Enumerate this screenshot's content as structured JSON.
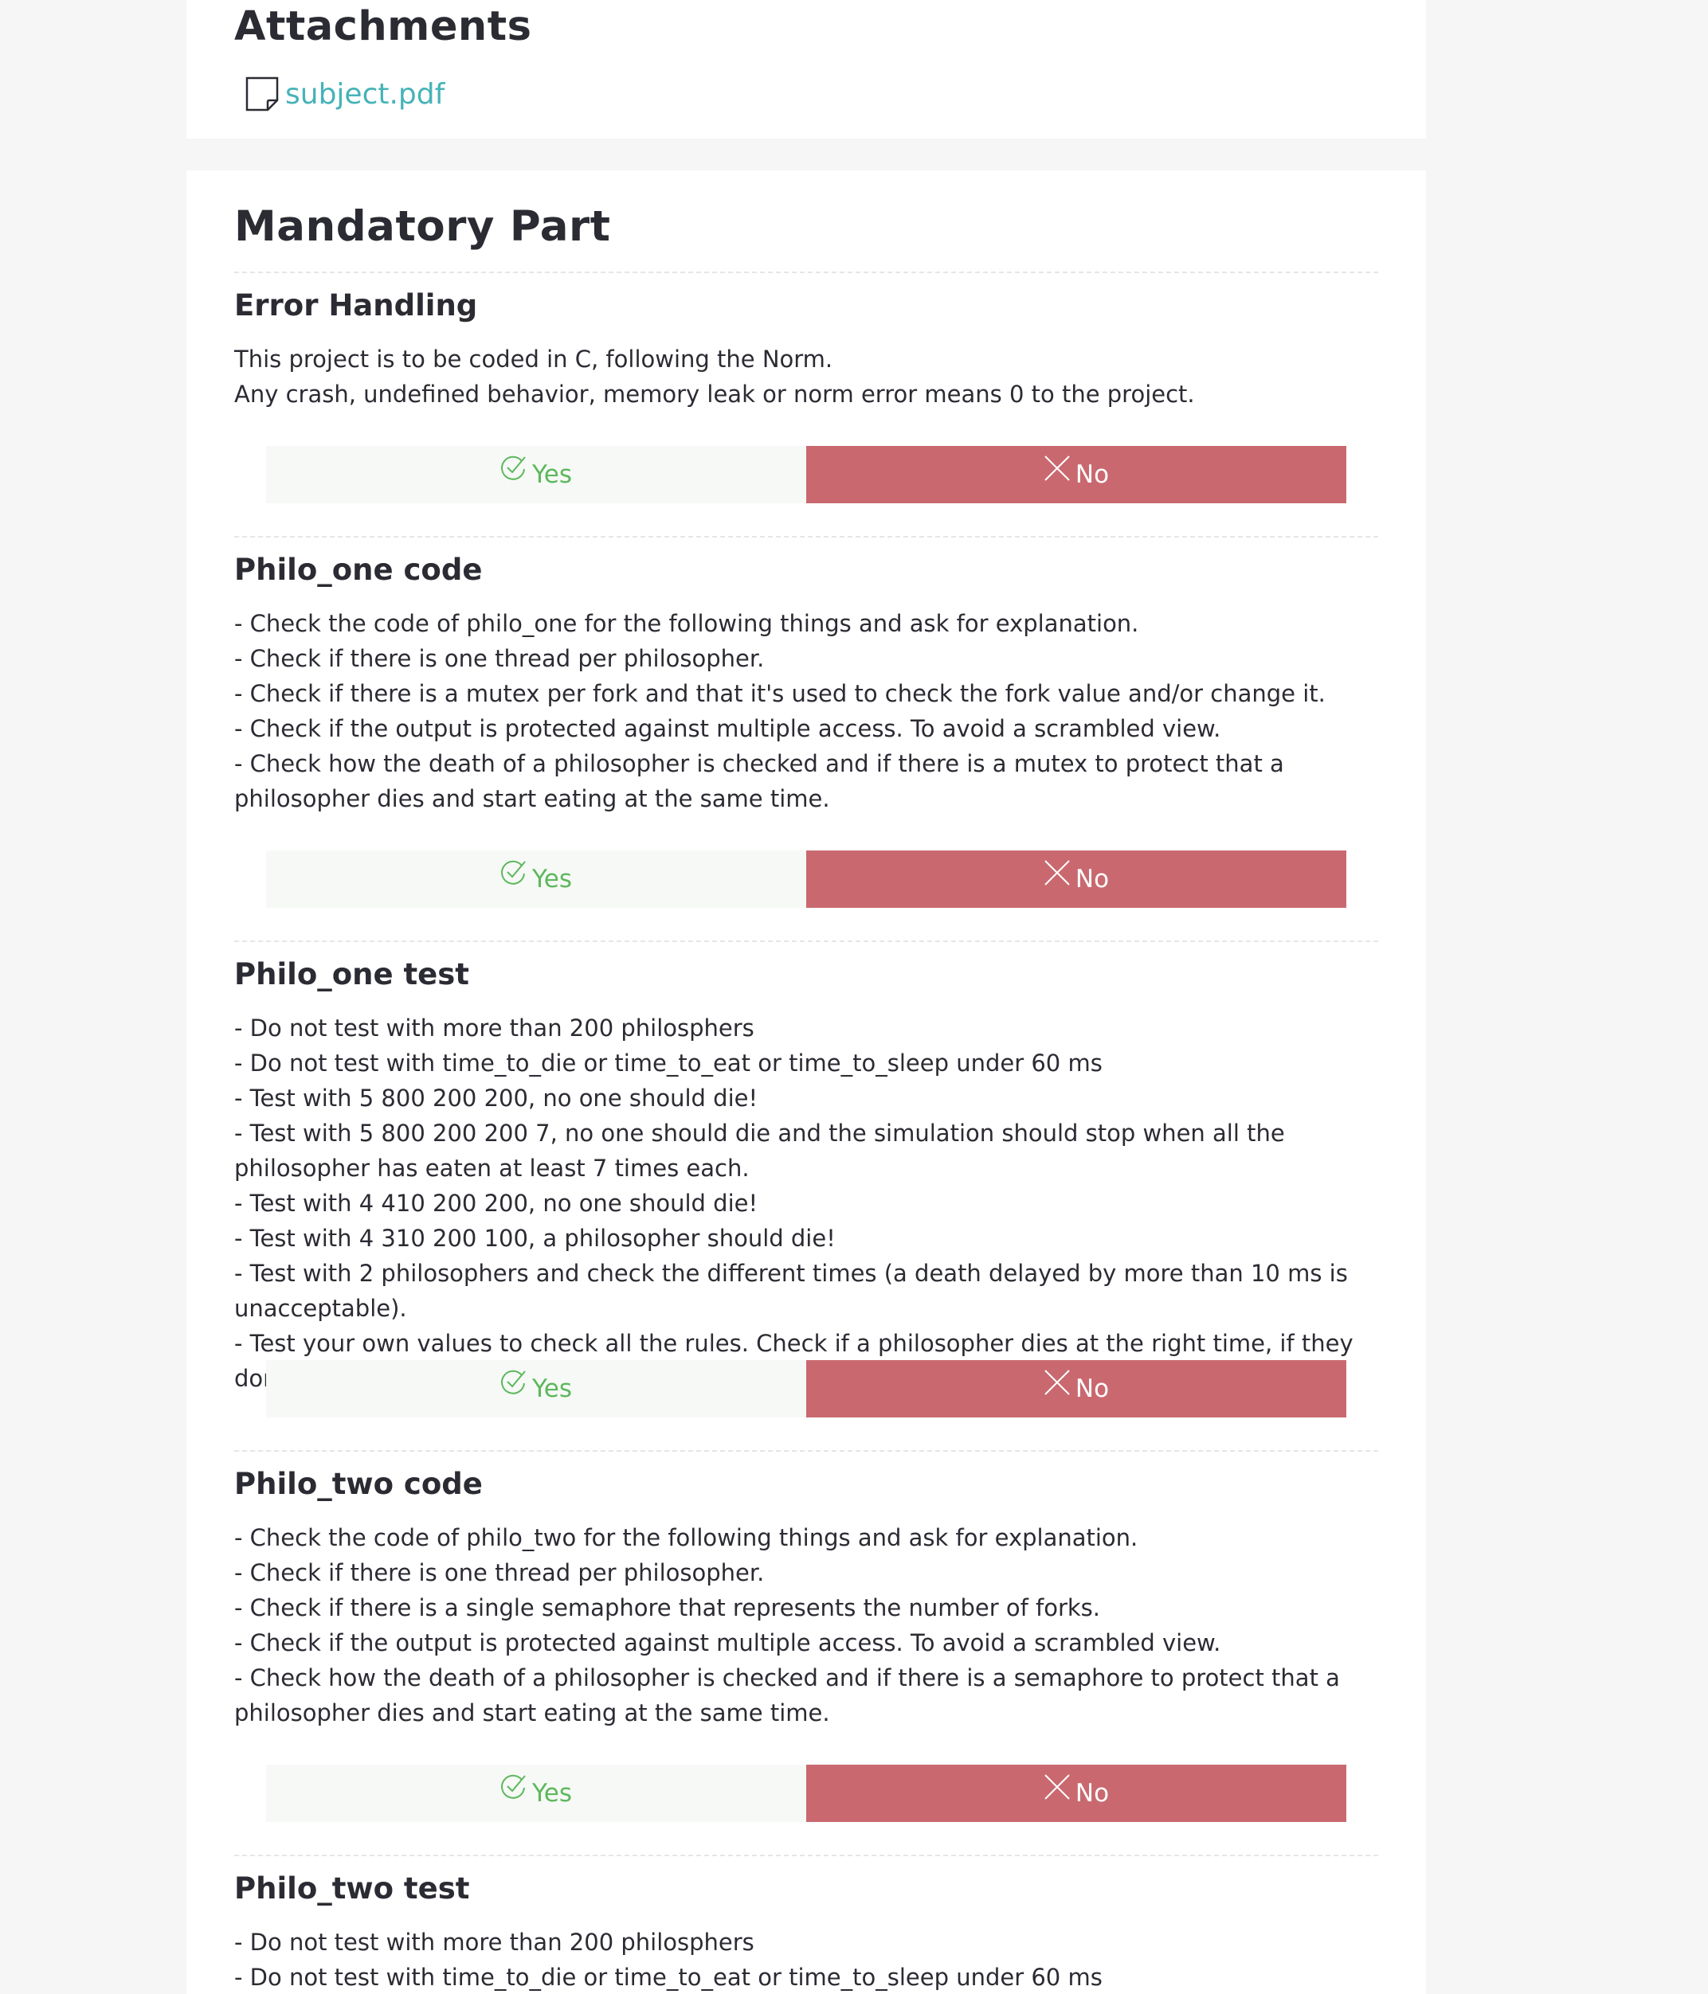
{
  "attachments": {
    "title": "Attachments",
    "file_name": "subject.pdf",
    "file_icon": "file-icon"
  },
  "mandatory": {
    "title": "Mandatory Part",
    "sections": [
      {
        "title": "Error Handling",
        "body": "This project is to be coded in C, following the Norm.\nAny crash, undefined behavior, memory leak or norm error means 0 to the project.",
        "yes_label": "Yes",
        "no_label": "No"
      },
      {
        "title": "Philo_one code",
        "body": "- Check the code of philo_one for the following things and ask for explanation.\n- Check if there is one thread per philosopher.\n- Check if there is a mutex per fork and that it's used to check the fork value and/or change it.\n- Check if the output is protected against multiple access. To avoid a scrambled view.\n- Check how the death of a philosopher is checked and if there is a mutex to protect that a philosopher dies and start eating at the same time.",
        "yes_label": "Yes",
        "no_label": "No"
      },
      {
        "title": "Philo_one test",
        "body": "- Do not test with more than 200 philosphers\n- Do not test with time_to_die or time_to_eat or time_to_sleep under 60 ms\n- Test with 5 800 200 200, no one should die!\n- Test with 5 800 200 200 7, no one should die and the simulation should stop when all the philosopher has eaten at least 7 times each.\n- Test with 4 410 200 200, no one should die!\n- Test with 4 310 200 100, a philosopher should die!\n- Test with 2 philosophers and check the different times (a death delayed by more than 10 ms is unacceptable).\n- Test your own values to check all the rules. Check if a philosopher dies at the right time, if they don't steal forks, etc.",
        "yes_label": "Yes",
        "no_label": "No"
      },
      {
        "title": "Philo_two code",
        "body": "- Check the code of philo_two for the following things and ask for explanation.\n- Check if there is one thread per philosopher.\n- Check if there is a single semaphore that represents the number of forks.\n- Check if the output is protected against multiple access. To avoid a scrambled view.\n- Check how the death of a philosopher is checked and if there is a semaphore to protect that a philosopher dies and start eating at the same time.",
        "yes_label": "Yes",
        "no_label": "No"
      },
      {
        "title": "Philo_two test",
        "body": "- Do not test with more than 200 philosphers\n- Do not test with time_to_die or time_to_eat or time_to_sleep under 60 ms"
      }
    ]
  },
  "icons": {
    "yes": "check-circle-icon",
    "no": "close-x-icon"
  },
  "colors": {
    "heading": "#2b2b33",
    "link": "#46b3b8",
    "yes_text": "#5cb85c",
    "yes_bg": "#f7f9f6",
    "no_bg": "#c9696f",
    "no_text": "#ffffff",
    "page_bg": "#f6f6f6"
  }
}
